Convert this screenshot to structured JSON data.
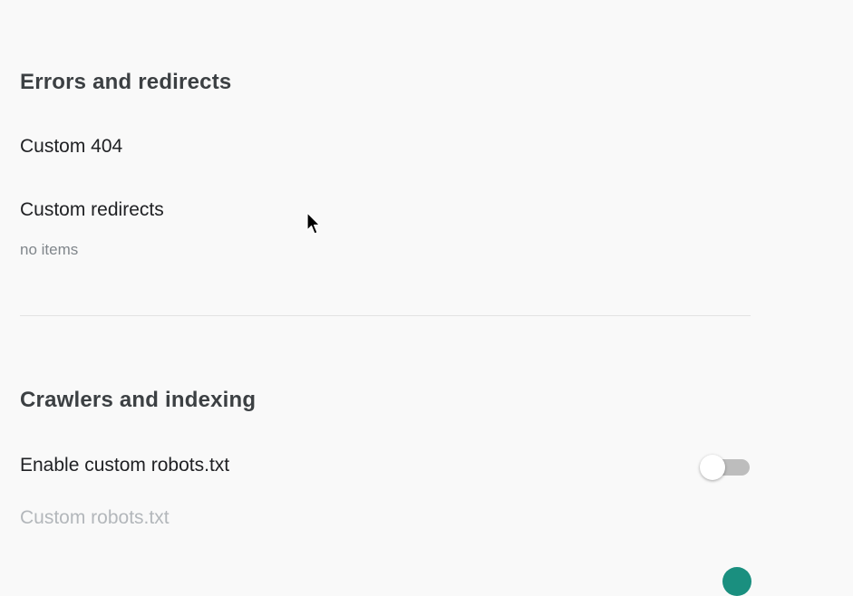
{
  "errors_section": {
    "title": "Errors and redirects",
    "custom_404_label": "Custom 404",
    "custom_redirects_label": "Custom redirects",
    "custom_redirects_value": "no items"
  },
  "crawlers_section": {
    "title": "Crawlers and indexing",
    "enable_robots_label": "Enable custom robots.txt",
    "enable_robots_state": "off",
    "custom_robots_label": "Custom robots.txt"
  },
  "colors": {
    "toggle_on_accent": "#1a8f7f",
    "toggle_off_track": "#bdbdbd"
  },
  "icons": {
    "pointer": "mouse-pointer-icon"
  }
}
